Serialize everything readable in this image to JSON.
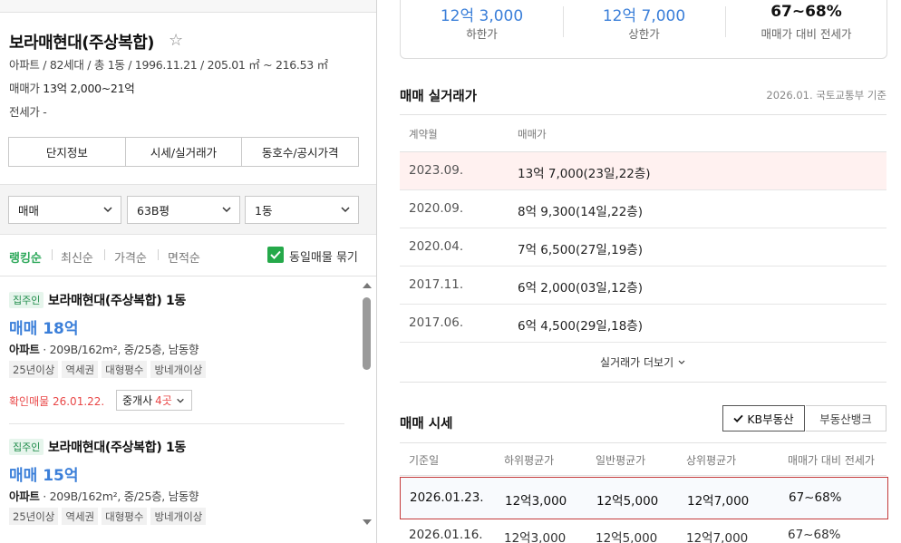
{
  "complex": {
    "name": "보라매현대(주상복합)",
    "summary": "아파트 / 82세대 / 총 1동 / 1996.11.21 / 205.01 ㎡ ~ 216.53 ㎡",
    "sale_label": "매매가",
    "sale_value": "13억 2,000~21억",
    "jeonse_label": "전세가",
    "jeonse_value": "-"
  },
  "info_tabs": [
    "단지정보",
    "시세/실거래가",
    "동호수/공시가격"
  ],
  "filters": {
    "trade_type": "매매",
    "area": "63B평",
    "building": "1동"
  },
  "sort": {
    "options": [
      "랭킹순",
      "최신순",
      "가격순",
      "면적순"
    ],
    "active": "랭킹순",
    "group_same_label": "동일매물 묶기"
  },
  "listings": [
    {
      "badge": "집주인",
      "title": "보라매현대(주상복합) 1동",
      "price": "매매 18억",
      "spec_type": "아파트",
      "spec_detail": "· 209B/162m², 중/25층, 남동향",
      "tags": [
        "25년이상",
        "역세권",
        "대형평수",
        "방네개이상"
      ],
      "confirm": "확인매물 26.01.22.",
      "agent_label": "중개사",
      "agent_count": "4곳"
    },
    {
      "badge": "집주인",
      "title": "보라매현대(주상복합) 1동",
      "price": "매매 15억",
      "spec_type": "아파트",
      "spec_detail": "· 209B/162m², 중/25층, 남동향",
      "tags": [
        "25년이상",
        "역세권",
        "대형평수",
        "방네개이상"
      ]
    }
  ],
  "price_range": [
    {
      "value": "12억 3,000",
      "label": "하한가"
    },
    {
      "value": "12억 7,000",
      "label": "상한가"
    },
    {
      "value": "67~68%",
      "label": "매매가 대비 전세가"
    }
  ],
  "transactions": {
    "title": "매매 실거래가",
    "note": "2026.01. 국토교통부 기준",
    "headers": [
      "계약월",
      "매매가"
    ],
    "rows": [
      {
        "month": "2023.09.",
        "price": "13억 7,000(23일,22층)"
      },
      {
        "month": "2020.09.",
        "price": "8억 9,300(14일,22층)"
      },
      {
        "month": "2020.04.",
        "price": "7억 6,500(27일,19층)"
      },
      {
        "month": "2017.11.",
        "price": "6억 2,000(03일,12층)"
      },
      {
        "month": "2017.06.",
        "price": "6억 4,500(29일,18층)"
      }
    ],
    "more_label": "실거래가 더보기"
  },
  "market_price": {
    "title": "매매 시세",
    "sources": [
      "KB부동산",
      "부동산뱅크"
    ],
    "active_source": "KB부동산",
    "headers": [
      "기준일",
      "하위평균가",
      "일반평균가",
      "상위평균가",
      "매매가 대비 전세가"
    ],
    "rows": [
      {
        "date": "2026.01.23.",
        "low": "12억3,000",
        "avg": "12억5,000",
        "high": "12억7,000",
        "ratio": "67~68%"
      },
      {
        "date": "2026.01.16.",
        "low": "12억3,000",
        "avg": "12억5,000",
        "high": "12억7,000",
        "ratio": "67~68%"
      }
    ]
  },
  "colors": {
    "accent_green": "#2da85a",
    "price_blue": "#3b7fd9",
    "alert_red": "#e94848",
    "highlight_border": "#c43a3a"
  }
}
